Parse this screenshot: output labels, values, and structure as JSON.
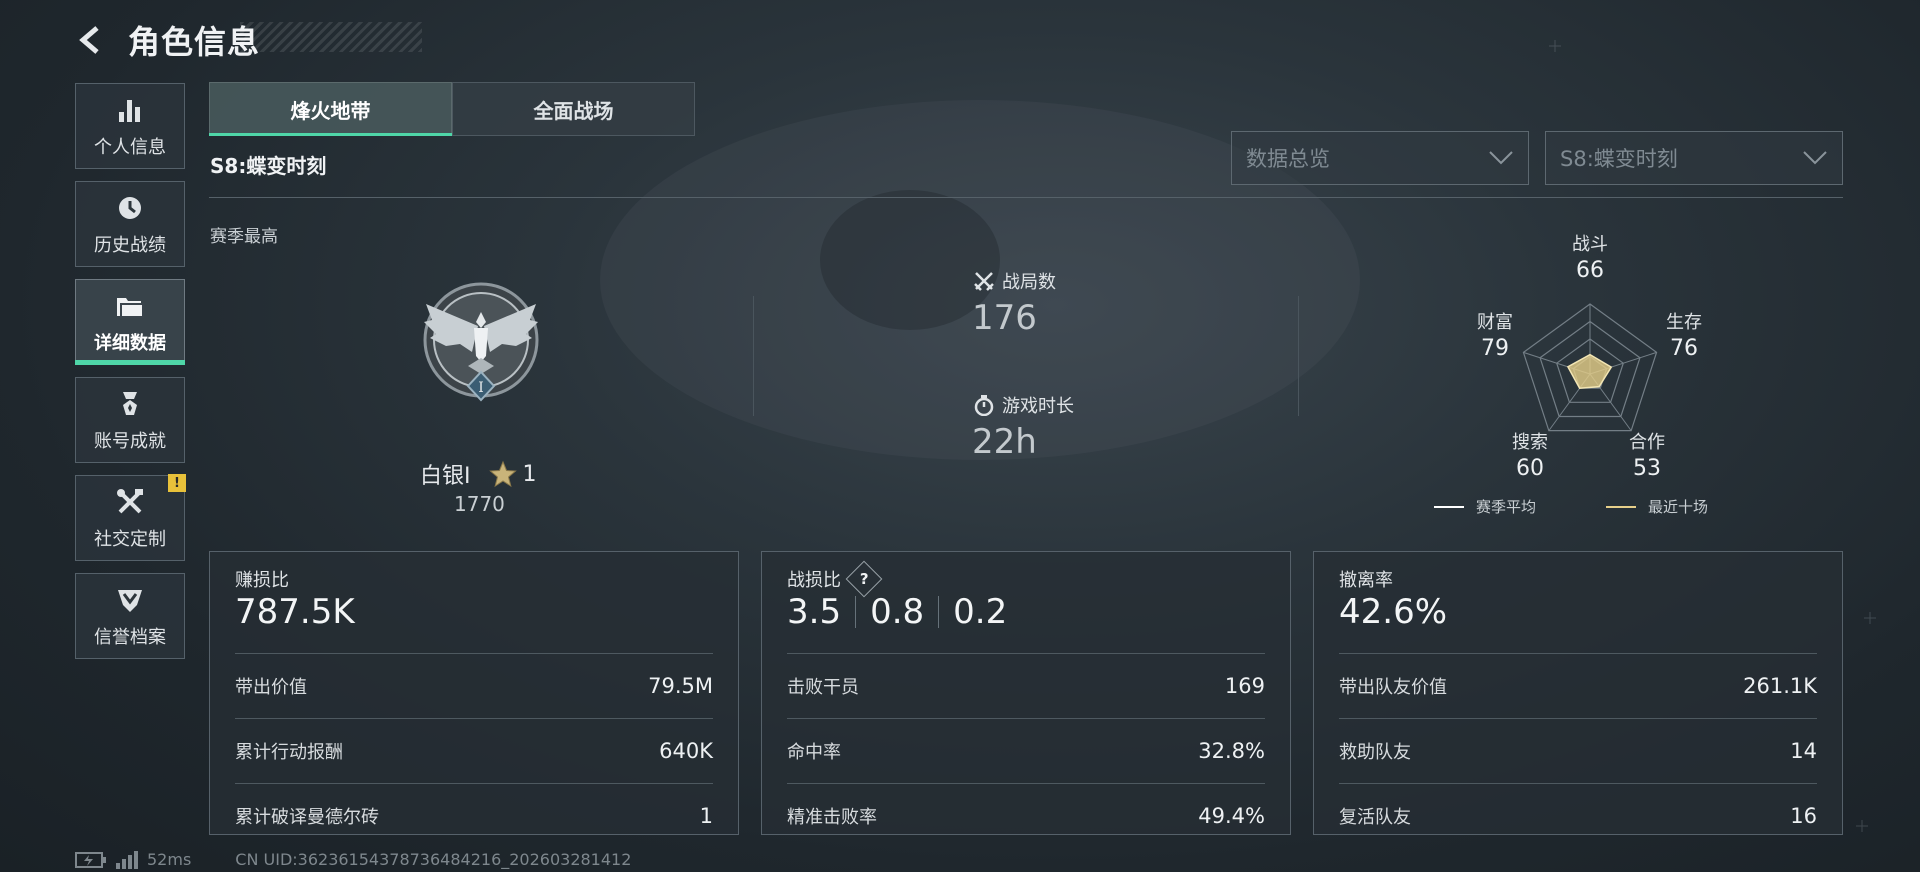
{
  "header": {
    "title": "角色信息"
  },
  "sidebar": {
    "items": [
      {
        "label": "个人信息",
        "icon": "bar-chart-icon"
      },
      {
        "label": "历史战绩",
        "icon": "history-icon"
      },
      {
        "label": "详细数据",
        "icon": "folder-icon",
        "active": true
      },
      {
        "label": "账号成就",
        "icon": "medal-icon"
      },
      {
        "label": "社交定制",
        "icon": "tools-icon",
        "badge": "!"
      },
      {
        "label": "信誉档案",
        "icon": "shield-icon"
      }
    ]
  },
  "tabs": [
    "烽火地带",
    "全面战场"
  ],
  "season": {
    "title": "S8:蝶变时刻"
  },
  "selects": {
    "mode": "数据总览",
    "season": "S8:蝶变时刻"
  },
  "season_best": {
    "label": "赛季最高",
    "rank_name": "白银I",
    "rank_emblem_numeral": "I",
    "stars": "1",
    "points": "1770"
  },
  "summary": {
    "matches_label": "战局数",
    "matches_value": "176",
    "playtime_label": "游戏时长",
    "playtime_value": "22h"
  },
  "radar": {
    "axes": [
      {
        "label": "战斗",
        "value": "66"
      },
      {
        "label": "生存",
        "value": "76"
      },
      {
        "label": "合作",
        "value": "53"
      },
      {
        "label": "搜索",
        "value": "60"
      },
      {
        "label": "财富",
        "value": "79"
      }
    ],
    "legend": [
      {
        "label": "赛季平均",
        "color": "#ffffff"
      },
      {
        "label": "最近十场",
        "color": "#e6cf8a"
      }
    ]
  },
  "cards": [
    {
      "label": "赚损比",
      "big": "787.5K",
      "rows": [
        {
          "label": "带出价值",
          "value": "79.5M"
        },
        {
          "label": "累计行动报酬",
          "value": "640K"
        },
        {
          "label": "累计破译曼德尔砖",
          "value": "1"
        }
      ]
    },
    {
      "label": "战损比",
      "help": "?",
      "bigs": [
        "3.5",
        "0.8",
        "0.2"
      ],
      "rows": [
        {
          "label": "击败干员",
          "value": "169"
        },
        {
          "label": "命中率",
          "value": "32.8%"
        },
        {
          "label": "精准击败率",
          "value": "49.4%"
        }
      ]
    },
    {
      "label": "撤离率",
      "big": "42.6%",
      "rows": [
        {
          "label": "带出队友价值",
          "value": "261.1K"
        },
        {
          "label": "救助队友",
          "value": "14"
        },
        {
          "label": "复活队友",
          "value": "16"
        }
      ]
    }
  ],
  "footer": {
    "ping": "52ms",
    "uid": "CN UID:3623615437873648​4216_202603281412"
  },
  "colors": {
    "accent": "#4fd6a8",
    "badge": "#e8c13a",
    "radar_fill": "#e6cf8a"
  }
}
